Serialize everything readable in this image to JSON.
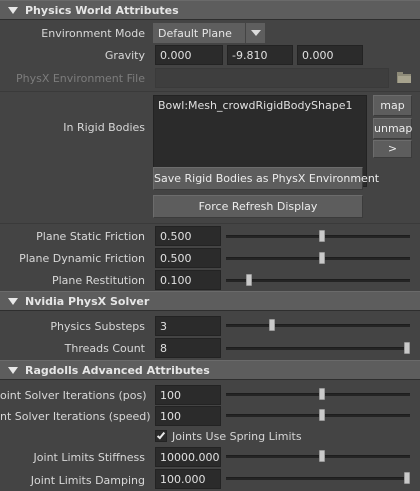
{
  "physics_world": {
    "title": "Physics World Attributes",
    "environment_mode_label": "Environment Mode",
    "environment_mode_value": "Default Plane",
    "gravity_label": "Gravity",
    "gravity": [
      "0.000",
      "-9.810",
      "0.000"
    ],
    "physx_env_file_label": "PhysX Environment File",
    "physx_env_file_value": "",
    "in_rigid_bodies_label": "In Rigid Bodies",
    "rigid_bodies": [
      "Bowl:Mesh_crowdRigidBodyShape1"
    ],
    "map_button": "map",
    "unmap_button": "unmap",
    "more_button": ">",
    "save_button": "Save Rigid Bodies as PhysX Environment",
    "refresh_button": "Force Refresh Display",
    "plane_static_friction_label": "Plane Static Friction",
    "plane_static_friction": {
      "value": "0.500",
      "level": 0.52
    },
    "plane_dynamic_friction_label": "Plane Dynamic Friction",
    "plane_dynamic_friction": {
      "value": "0.500",
      "level": 0.52
    },
    "plane_restitution_label": "Plane Restitution",
    "plane_restitution": {
      "value": "0.100",
      "level": 0.11
    }
  },
  "physx_solver": {
    "title": "Nvidia PhysX Solver",
    "physics_substeps_label": "Physics Substeps",
    "physics_substeps": {
      "value": "3",
      "level": 0.24
    },
    "threads_count_label": "Threads Count",
    "threads_count": {
      "value": "8",
      "level": 1.0
    }
  },
  "ragdolls": {
    "title": "Ragdolls Advanced Attributes",
    "joint_solver_pos_label": "oint Solver Iterations (pos)",
    "joint_solver_pos": {
      "value": "100",
      "level": 0.52
    },
    "joint_solver_speed_label": "nt Solver Iterations (speed)",
    "joint_solver_speed": {
      "value": "100",
      "level": 0.52
    },
    "joints_use_spring_label": "Joints Use Spring Limits",
    "joints_use_spring_checked": true,
    "joint_limits_stiffness_label": "Joint Limits Stiffness",
    "joint_limits_stiffness": {
      "value": "10000.000",
      "level": 0.52
    },
    "joint_limits_damping_label": "Joint Limits Damping",
    "joint_limits_damping": {
      "value": "100.000",
      "level": 1.0
    }
  },
  "icons": {
    "section_toggle": "triangle-down-icon",
    "dropdown": "chevron-down-icon",
    "folder": "folder-icon",
    "checkbox": "checkmark-icon"
  }
}
